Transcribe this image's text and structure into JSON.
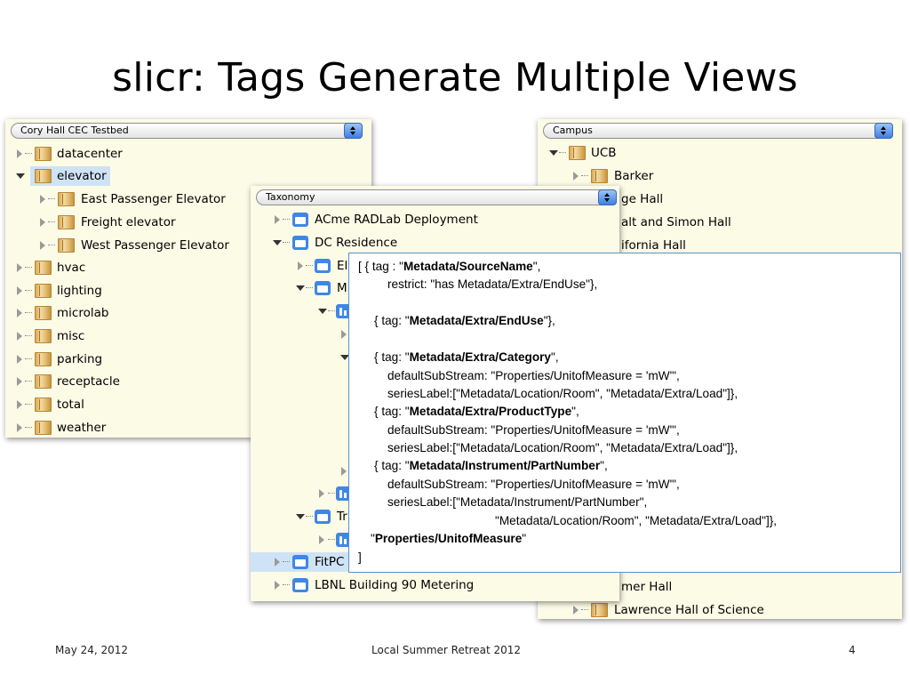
{
  "slide": {
    "title": "slicr: Tags Generate Multiple Views",
    "footer_date": "May 24, 2012",
    "footer_center": "Local Summer Retreat 2012",
    "footer_page": "4"
  },
  "left_panel": {
    "selector": "Cory Hall CEC Testbed",
    "items": [
      {
        "label": "datacenter"
      },
      {
        "label": "elevator"
      },
      {
        "label": "East Passenger Elevator"
      },
      {
        "label": "Freight elevator"
      },
      {
        "label": "West Passenger Elevator"
      },
      {
        "label": "hvac"
      },
      {
        "label": "lighting"
      },
      {
        "label": "microlab"
      },
      {
        "label": "misc"
      },
      {
        "label": "parking"
      },
      {
        "label": "receptacle"
      },
      {
        "label": "total"
      },
      {
        "label": "weather"
      }
    ]
  },
  "right_panel": {
    "selector": "Campus",
    "items": [
      {
        "label": "UCB"
      },
      {
        "label": "Barker"
      },
      {
        "label": "ge Hall"
      },
      {
        "label": "alt and Simon Hall"
      },
      {
        "label": "ifornia Hall"
      },
      {
        "label": "mer Hall"
      },
      {
        "label": "Lawrence Hall of Science"
      }
    ]
  },
  "middle_panel": {
    "selector": "Taxonomy",
    "items": [
      {
        "label": "ACme RADLab Deployment"
      },
      {
        "label": "DC Residence"
      },
      {
        "label": "El"
      },
      {
        "label": "M"
      },
      {
        "label": "Tr"
      },
      {
        "label": "FitPC"
      },
      {
        "label": "LBNL Building 90 Metering"
      }
    ]
  },
  "code": {
    "l1_a": "[ { tag : \"",
    "l1_b": "Metadata/SourceName",
    "l1_c": "\",",
    "l2": "restrict: \"has Metadata/Extra/EndUse\"},",
    "l3_a": "{ tag: \"",
    "l3_b": "Metadata/Extra/EndUse",
    "l3_c": "\"},",
    "l4_a": "{ tag: \"",
    "l4_b": "Metadata/Extra/Category",
    "l4_c": "\",",
    "l5": "defaultSubStream: \"Properties/UnitofMeasure = 'mW'\",",
    "l6": "seriesLabel:[\"Metadata/Location/Room\", \"Metadata/Extra/Load\"]},",
    "l7_a": "{ tag: \"",
    "l7_b": "Metadata/Extra/ProductType",
    "l7_c": "\",",
    "l8": "defaultSubStream: \"Properties/UnitofMeasure = 'mW'\",",
    "l9": "seriesLabel:[\"Metadata/Location/Room\", \"Metadata/Extra/Load\"]},",
    "l10_a": "{ tag: \"",
    "l10_b": "Metadata/Instrument/PartNumber",
    "l10_c": "\",",
    "l11": "defaultSubStream: \"Properties/UnitofMeasure = 'mW'\",",
    "l12": "seriesLabel:[\"Metadata/Instrument/PartNumber\",",
    "l13": "\"Metadata/Location/Room\", \"Metadata/Extra/Load\"]},",
    "l14_a": "\"",
    "l14_b": "Properties/UnitofMeasure",
    "l14_c": "\"",
    "l15": "]"
  }
}
